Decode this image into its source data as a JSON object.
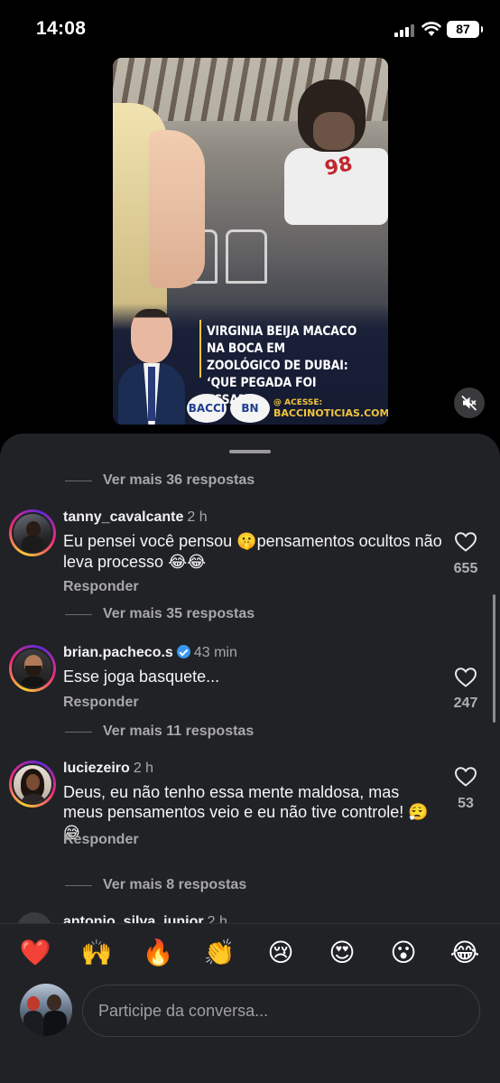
{
  "status_bar": {
    "time": "14:08",
    "battery": "87"
  },
  "video": {
    "headline": "VIRGINIA BEIJA MACACO NA BOCA EM ZOOLÓGICO DE DUBAI: ‘QUE PEGADA FOI ESSA?’",
    "site_label": "@ ACESSE:",
    "site_url": "BACCINOTICIAS.COM.BR",
    "logo1": "BACCI",
    "logo2": "BN",
    "jersey_number": "98"
  },
  "comments": {
    "more_replies": [
      "Ver mais 36 respostas",
      "Ver mais 35 respostas",
      "Ver mais 11 respostas",
      "Ver mais 8 respostas"
    ],
    "items": [
      {
        "username": "tanny_cavalcante",
        "time": "2 h",
        "text_part1": "Eu pensei você pensou ",
        "emoji1": "🤫",
        "text_part2": "pensamentos ocultos não leva processo ",
        "emoji2": "😂😂",
        "reply": "Responder",
        "likes": "655"
      },
      {
        "username": "brian.pacheco.s",
        "time": "43 min",
        "text": "Esse joga basquete...",
        "reply": "Responder",
        "likes": "247"
      },
      {
        "username": "luciezeiro",
        "time": "2 h",
        "text": "Deus, eu não tenho essa mente maldosa, mas meus pensamentos veio e eu não tive controle! ",
        "emoji": "😮‍💨😅",
        "reply": "Responder",
        "likes": "53"
      }
    ],
    "peek_username": "antonio_silva_junior",
    "peek_time": "2 h"
  },
  "composer": {
    "reactions": [
      "❤️",
      "🙌",
      "🔥",
      "👏",
      "😢",
      "😍",
      "😮",
      "😂"
    ],
    "placeholder": "Participe da conversa..."
  },
  "colors": {
    "sheet_bg": "#202225",
    "accent_verified": "#3897f0",
    "headline_yellow": "#f2c53d"
  }
}
